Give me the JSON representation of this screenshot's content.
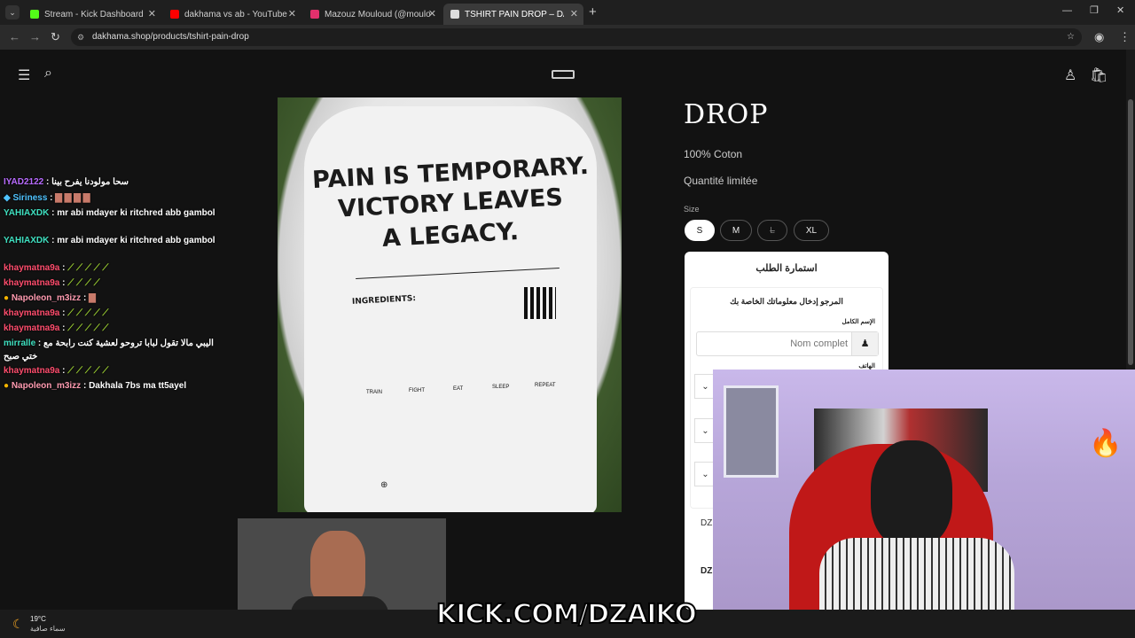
{
  "browser": {
    "tabs": [
      {
        "title": "Stream - Kick Dashboard",
        "color": "#53fc18"
      },
      {
        "title": "dakhama vs ab - YouTube",
        "color": "#ff0000"
      },
      {
        "title": "Mazouz Mouloud (@mouloud_",
        "color": "#e1306c"
      },
      {
        "title": "TSHIRT PAIN DROP – DAKHAMA",
        "color": "#ffffff"
      }
    ],
    "new_tab": "+",
    "url": "dakhama.shop/products/tshirt-pain-drop"
  },
  "store": {
    "product_title": "DROP",
    "material": "100% Coton",
    "stock_note": "Quantité limitée",
    "size_label": "Size",
    "sizes": [
      "S",
      "M",
      "L",
      "XL"
    ],
    "selected_size": "S",
    "shirt_print": {
      "line1": "PAIN IS TEMPORARY.",
      "line2": "VICTORY LEAVES",
      "line3": "A LEGACY.",
      "ingredients": "INGREDIENTS:",
      "icons": [
        "TRAIN",
        "FIGHT",
        "EAT",
        "SLEEP",
        "REPEAT"
      ]
    },
    "form": {
      "title": "استمارة الطلب",
      "subtitle": "المرجو إدخال معلوماتك الخاصة بك",
      "name_label": "الإسم الكامل",
      "name_placeholder": "Nom complet",
      "phone_label": "الهاتف",
      "dz1": "DZ",
      "dz2": "DZ"
    }
  },
  "chat": [
    {
      "user": "IYAD2122",
      "msg": "سحا مولودنا يفرح بينا",
      "color": "#b86bff"
    },
    {
      "user": "Siriness",
      "msg": "",
      "color": "#4fc3ff"
    },
    {
      "user": "YAHIAXDK",
      "msg": "mr abi mdayer ki ritchred abb gambol",
      "color": "#3fe0c0"
    },
    {
      "user": "YAHIAXDK",
      "msg": "mr abi mdayer ki ritchred abb gambol",
      "color": "#3fe0c0"
    },
    {
      "user": "khaymatna9a",
      "msg": "",
      "color": "#ff4d6d"
    },
    {
      "user": "khaymatna9a",
      "msg": "",
      "color": "#ff4d6d"
    },
    {
      "user": "Napoleon_m3izz",
      "msg": "",
      "color": "#ff9bb0"
    },
    {
      "user": "khaymatna9a",
      "msg": "",
      "color": "#ff4d6d"
    },
    {
      "user": "khaymatna9a",
      "msg": "",
      "color": "#ff4d6d"
    },
    {
      "user": "mirralle",
      "msg": "اليبي مالا تقول لبابا تروحو لعشية كنت رابحة مع ختي صبح",
      "color": "#3fe0c0"
    },
    {
      "user": "khaymatna9a",
      "msg": "",
      "color": "#ff4d6d"
    },
    {
      "user": "Napoleon_m3izz",
      "msg": "Dakhala 7bs ma tt5ayel",
      "color": "#ff9bb0"
    }
  ],
  "overlay": {
    "kick_text": "KICK.COM/DZAIKO"
  },
  "taskbar": {
    "temp": "19°C",
    "weather": "سماء صافية"
  }
}
